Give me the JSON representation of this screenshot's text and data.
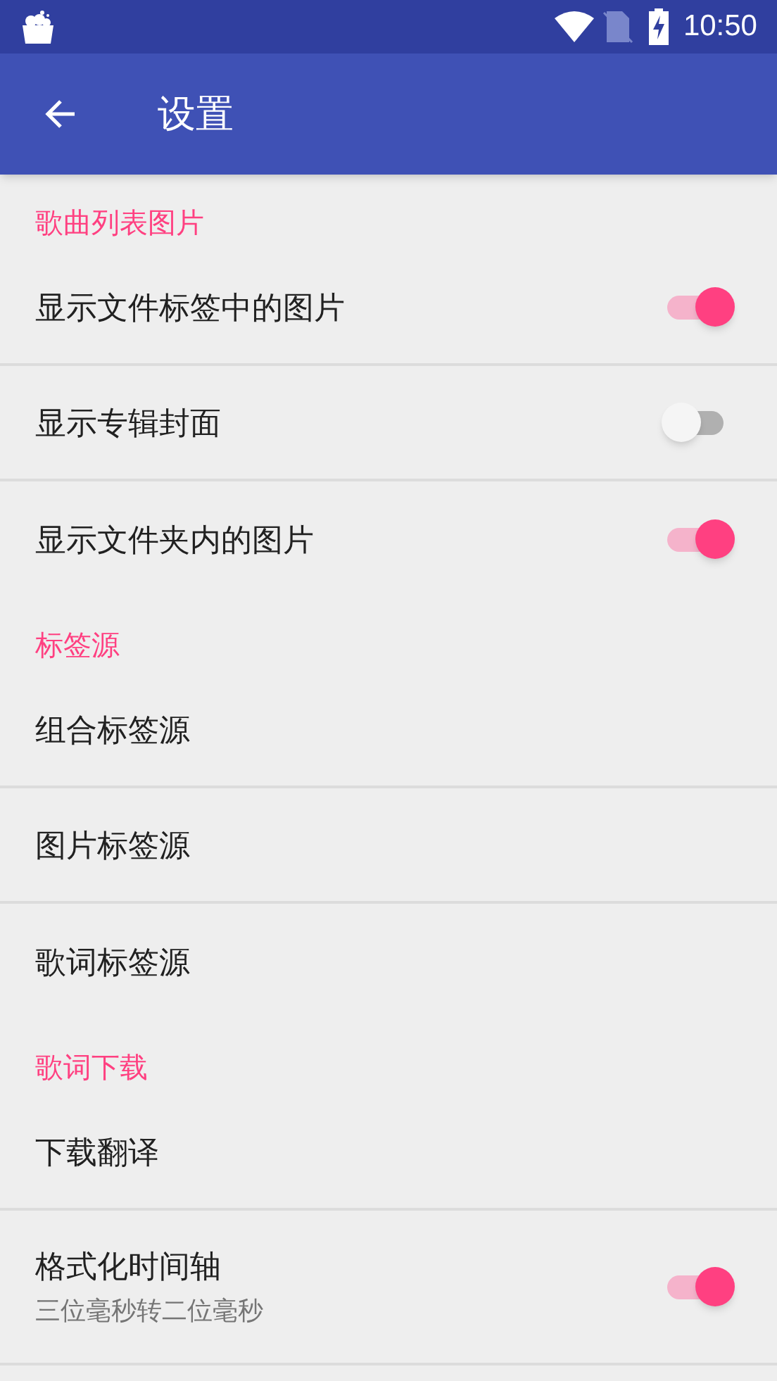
{
  "status_bar": {
    "time": "10:50"
  },
  "toolbar": {
    "title": "设置"
  },
  "sections": [
    {
      "header": "歌曲列表图片",
      "items": [
        {
          "title": "显示文件标签中的图片",
          "kind": "switch",
          "on": true
        },
        {
          "title": "显示专辑封面",
          "kind": "switch",
          "on": false
        },
        {
          "title": "显示文件夹内的图片",
          "kind": "switch",
          "on": true
        }
      ]
    },
    {
      "header": "标签源",
      "items": [
        {
          "title": "组合标签源",
          "kind": "plain"
        },
        {
          "title": "图片标签源",
          "kind": "plain"
        },
        {
          "title": "歌词标签源",
          "kind": "plain"
        }
      ]
    },
    {
      "header": "歌词下载",
      "items": [
        {
          "title": "下载翻译",
          "kind": "plain"
        },
        {
          "title": "格式化时间轴",
          "summary": "三位毫秒转二位毫秒",
          "kind": "switch",
          "on": true
        }
      ]
    }
  ]
}
